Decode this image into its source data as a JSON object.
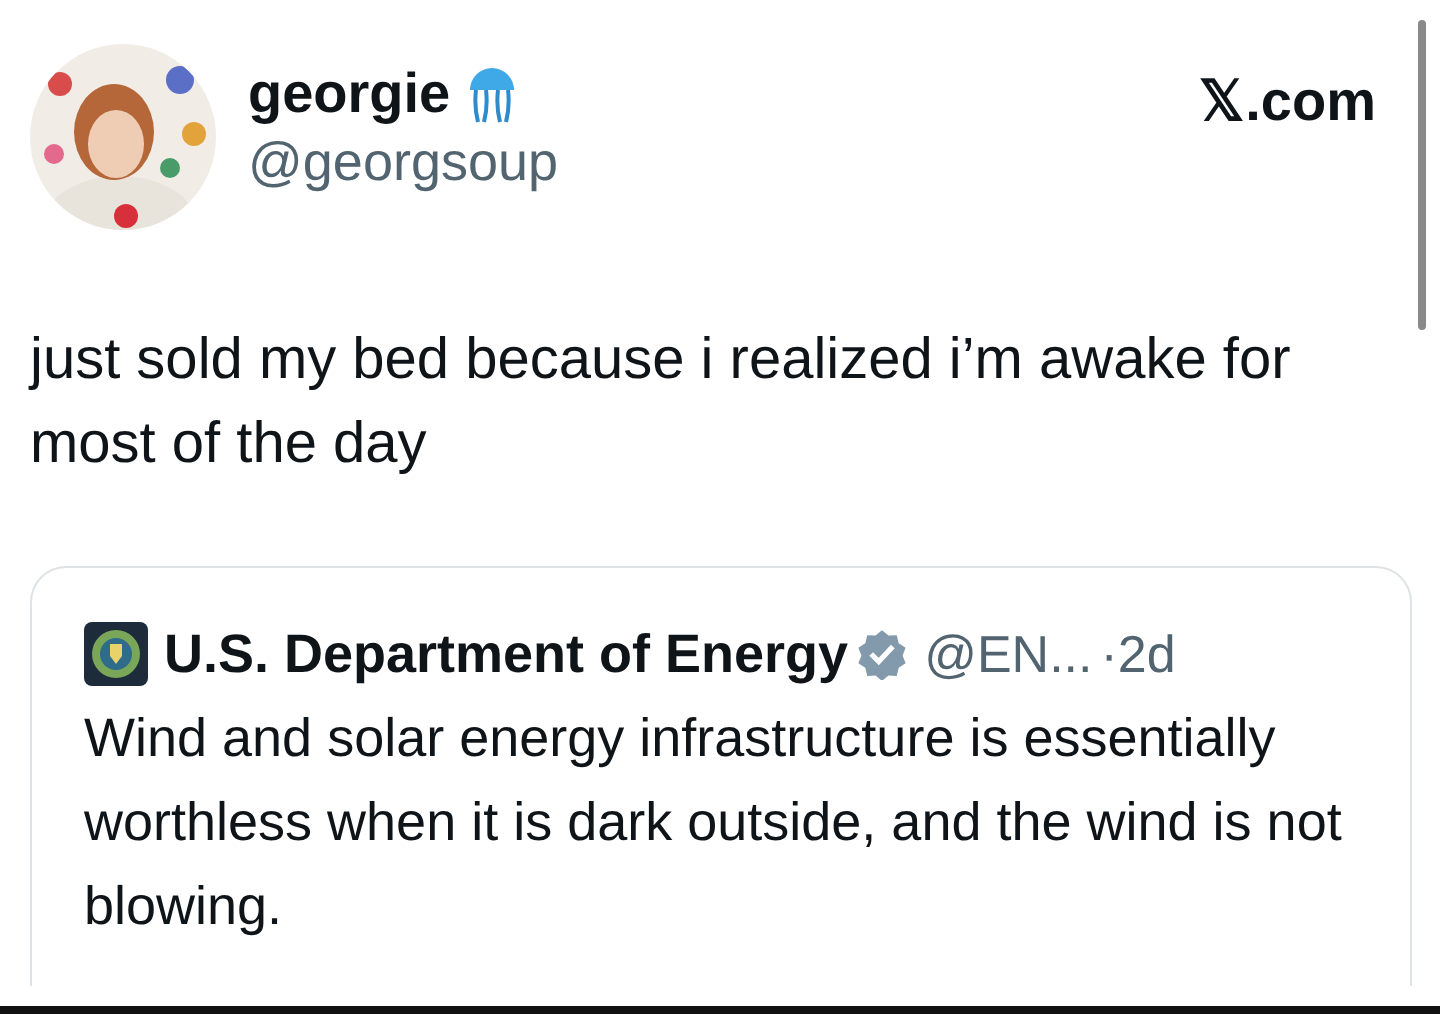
{
  "author": {
    "name": "georgie",
    "handle": "@georgsoup"
  },
  "site": {
    "x_glyph": "𝕏",
    "domain": ".com"
  },
  "text": "just sold my bed because i realized i’m awake for most of the day",
  "quote": {
    "name": "U.S. Department of Energy",
    "verified": true,
    "handle": "@EN...",
    "separator": "·",
    "time": "2d",
    "text": "Wind and solar energy infrastructure is essentially worthless when it is dark outside, and the wind is not blowing."
  }
}
